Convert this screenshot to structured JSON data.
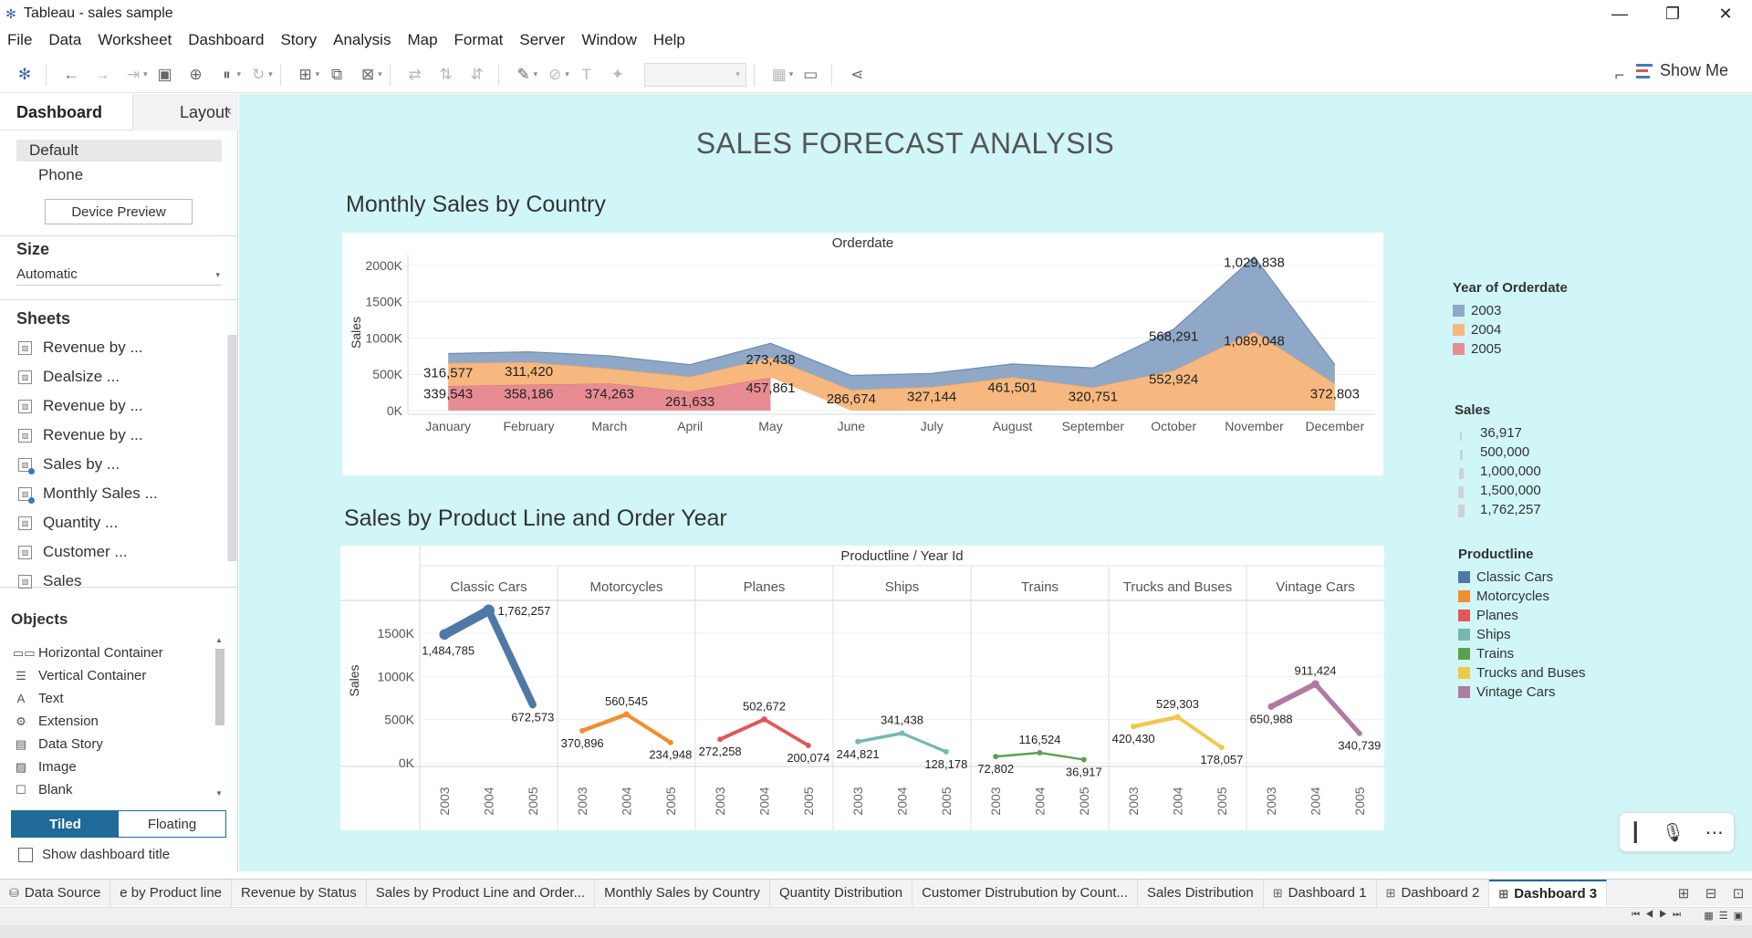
{
  "window": {
    "title": "Tableau - sales sample",
    "controls": [
      "minimize",
      "restore",
      "close"
    ]
  },
  "menu": [
    "File",
    "Data",
    "Worksheet",
    "Dashboard",
    "Story",
    "Analysis",
    "Map",
    "Format",
    "Server",
    "Window",
    "Help"
  ],
  "toolbar": {
    "show_me_label": "Show Me",
    "icons": [
      "tableau-logo-icon",
      "undo-icon",
      "redo-icon",
      "replay-icon",
      "save-icon",
      "new-datasource-icon",
      "pause-icon",
      "refresh-icon",
      "new-worksheet-icon",
      "duplicate-icon",
      "clear-icon",
      "swap-icon",
      "sort-asc-icon",
      "sort-desc-icon",
      "highlight-icon",
      "group-icon",
      "label-icon",
      "pin-icon",
      "fit-dropdown",
      "chart-icon",
      "presentation-icon",
      "share-icon",
      "paint-icon"
    ]
  },
  "left_panel": {
    "tab_dashboard": "Dashboard",
    "tab_layout": "Layout",
    "device_default": "Default",
    "device_phone": "Phone",
    "device_preview_button": "Device Preview",
    "size_heading": "Size",
    "size_value": "Automatic",
    "sheets_heading": "Sheets",
    "sheets": [
      {
        "label": "Revenue by ...",
        "dashboard_ref": false
      },
      {
        "label": "Dealsize ...",
        "dashboard_ref": false
      },
      {
        "label": "Revenue by ...",
        "dashboard_ref": false
      },
      {
        "label": "Revenue by ...",
        "dashboard_ref": false
      },
      {
        "label": "Sales by ...",
        "dashboard_ref": true
      },
      {
        "label": "Monthly Sales ...",
        "dashboard_ref": true
      },
      {
        "label": "Quantity ...",
        "dashboard_ref": false
      },
      {
        "label": "Customer ...",
        "dashboard_ref": false
      },
      {
        "label": "Sales",
        "dashboard_ref": false
      }
    ],
    "objects_heading": "Objects",
    "objects": [
      {
        "label": "Horizontal Container",
        "icon": "horizontal-container-icon",
        "glyph": "▭▭"
      },
      {
        "label": "Vertical Container",
        "icon": "vertical-container-icon",
        "glyph": "☰"
      },
      {
        "label": "Text",
        "icon": "text-icon",
        "glyph": "A"
      },
      {
        "label": "Extension",
        "icon": "extension-icon",
        "glyph": "⚙"
      },
      {
        "label": "Data Story",
        "icon": "data-story-icon",
        "glyph": "▤"
      },
      {
        "label": "Image",
        "icon": "image-icon",
        "glyph": "▨"
      },
      {
        "label": "Blank",
        "icon": "blank-icon",
        "glyph": "☐"
      }
    ],
    "tiled_label": "Tiled",
    "floating_label": "Floating",
    "show_title_label": "Show dashboard title"
  },
  "dashboard": {
    "title": "SALES FORECAST ANALYSIS",
    "section1_title": "Monthly Sales by Country",
    "section2_title": "Sales by Product Line and Order Year",
    "background": "#d1f6f7"
  },
  "legends": {
    "year": {
      "title": "Year of Orderdate",
      "items": [
        {
          "label": "2003",
          "color": "#8fa8c8"
        },
        {
          "label": "2004",
          "color": "#f6b87e"
        },
        {
          "label": "2005",
          "color": "#e88c93"
        }
      ]
    },
    "sales": {
      "title": "Sales",
      "items": [
        {
          "label": "36,917",
          "level": 0.02
        },
        {
          "label": "500,000",
          "level": 0.28
        },
        {
          "label": "1,000,000",
          "level": 0.57
        },
        {
          "label": "1,500,000",
          "level": 0.85
        },
        {
          "label": "1,762,257",
          "level": 1.0
        }
      ]
    },
    "productline": {
      "title": "Productline",
      "items": [
        {
          "label": "Classic Cars",
          "color": "#4e79a7"
        },
        {
          "label": "Motorcycles",
          "color": "#f28e2b"
        },
        {
          "label": "Planes",
          "color": "#e15759"
        },
        {
          "label": "Ships",
          "color": "#76b7b2"
        },
        {
          "label": "Trains",
          "color": "#59a14f"
        },
        {
          "label": "Trucks and Buses",
          "color": "#edc948"
        },
        {
          "label": "Vintage Cars",
          "color": "#b07aa1"
        }
      ]
    }
  },
  "chart_data": [
    {
      "type": "area",
      "title": "Orderdate",
      "xlabel": "",
      "ylabel": "Sales",
      "categories": [
        "January",
        "February",
        "March",
        "April",
        "May",
        "June",
        "July",
        "August",
        "September",
        "October",
        "November",
        "December"
      ],
      "yticks": [
        "0K",
        "500K",
        "1000K",
        "1500K",
        "2000K"
      ],
      "ylim": [
        0,
        2150000
      ],
      "stacked": true,
      "series": [
        {
          "name": "2005",
          "color": "#e88c93",
          "values": [
            339543,
            358186,
            374263,
            261633,
            457861,
            null,
            null,
            null,
            null,
            null,
            null,
            null
          ]
        },
        {
          "name": "2004",
          "color": "#f6b87e",
          "values": [
            316577,
            311420,
            205733,
            206148,
            273438,
            286674,
            327144,
            461501,
            320751,
            552924,
            1089048,
            372803
          ]
        },
        {
          "name": "2003",
          "color": "#8fa8c8",
          "values": [
            129753,
            140614,
            175282,
            164611,
            196304,
            195860,
            185008,
            181021,
            267249,
            568291,
            1029838,
            259552
          ]
        }
      ],
      "labels": [
        {
          "text": "339,543",
          "category": "January",
          "value": 120000
        },
        {
          "text": "358,186",
          "category": "February",
          "value": 120000
        },
        {
          "text": "374,263",
          "category": "March",
          "value": 120000
        },
        {
          "text": "261,633",
          "category": "April",
          "value": 12000
        },
        {
          "text": "457,861",
          "category": "May",
          "value": 200000
        },
        {
          "text": "316,577",
          "category": "January",
          "value": 410000
        },
        {
          "text": "311,420",
          "category": "February",
          "value": 430000
        },
        {
          "text": "273,438",
          "category": "May",
          "value": 590000
        },
        {
          "text": "286,674",
          "category": "June",
          "value": 50000
        },
        {
          "text": "327,144",
          "category": "July",
          "value": 80000
        },
        {
          "text": "461,501",
          "category": "August",
          "value": 210000
        },
        {
          "text": "320,751",
          "category": "September",
          "value": 80000
        },
        {
          "text": "552,924",
          "category": "October",
          "value": 320000
        },
        {
          "text": "1,089,048",
          "category": "November",
          "value": 850000
        },
        {
          "text": "372,803",
          "category": "December",
          "value": 120000
        },
        {
          "text": "568,291",
          "category": "October",
          "value": 910000
        },
        {
          "text": "1,029,838",
          "category": "November",
          "value": 1930000
        }
      ]
    },
    {
      "type": "line",
      "title": "Productline / Year Id",
      "xlabel": "",
      "ylabel": "Sales",
      "x": [
        "2003",
        "2004",
        "2005"
      ],
      "yticks": [
        "0K",
        "500K",
        "1000K",
        "1500K"
      ],
      "ylim": [
        0,
        1900000
      ],
      "panels": [
        {
          "name": "Classic Cars",
          "color": "#4e79a7",
          "values": [
            1484785,
            1762257,
            672573
          ],
          "labels": [
            "1,484,785",
            "1,762,257",
            "672,573"
          ]
        },
        {
          "name": "Motorcycles",
          "color": "#f28e2b",
          "values": [
            370896,
            560545,
            234948
          ],
          "labels": [
            "370,896",
            "560,545",
            "234,948"
          ]
        },
        {
          "name": "Planes",
          "color": "#e15759",
          "values": [
            272258,
            502672,
            200074
          ],
          "labels": [
            "272,258",
            "502,672",
            "200,074"
          ]
        },
        {
          "name": "Ships",
          "color": "#76b7b2",
          "values": [
            244821,
            341438,
            128178
          ],
          "labels": [
            "244,821",
            "341,438",
            "128,178"
          ]
        },
        {
          "name": "Trains",
          "color": "#59a14f",
          "values": [
            72802,
            116524,
            36917
          ],
          "labels": [
            "72,802",
            "116,524",
            "36,917"
          ]
        },
        {
          "name": "Trucks and Buses",
          "color": "#edc948",
          "values": [
            420430,
            529303,
            178057
          ],
          "labels": [
            "420,430",
            "529,303",
            "178,057"
          ]
        },
        {
          "name": "Vintage Cars",
          "color": "#b07aa1",
          "values": [
            650988,
            911424,
            340739
          ],
          "labels": [
            "650,988",
            "911,424",
            "340,739"
          ]
        }
      ]
    }
  ],
  "bottom_tabs": [
    {
      "label": "Data Source",
      "icon": "⛁",
      "icon_name": "data-source-icon",
      "active": false
    },
    {
      "label": "e by Product line",
      "icon": "",
      "icon_name": "",
      "active": false
    },
    {
      "label": "Revenue by Status",
      "icon": "",
      "icon_name": "",
      "active": false
    },
    {
      "label": "Sales by Product Line and Order...",
      "icon": "",
      "icon_name": "",
      "active": false
    },
    {
      "label": "Monthly Sales by Country",
      "icon": "",
      "icon_name": "",
      "active": false
    },
    {
      "label": "Quantity Distribution",
      "icon": "",
      "icon_name": "",
      "active": false
    },
    {
      "label": "Customer Distrubution by Count...",
      "icon": "",
      "icon_name": "",
      "active": false
    },
    {
      "label": "Sales Distribution",
      "icon": "",
      "icon_name": "",
      "active": false
    },
    {
      "label": "Dashboard 1",
      "icon": "⊞",
      "icon_name": "dashboard-tab-icon",
      "active": false
    },
    {
      "label": "Dashboard 2",
      "icon": "⊞",
      "icon_name": "dashboard-tab-icon",
      "active": false
    },
    {
      "label": "Dashboard 3",
      "icon": "⊞",
      "icon_name": "dashboard-tab-icon",
      "active": true
    }
  ]
}
